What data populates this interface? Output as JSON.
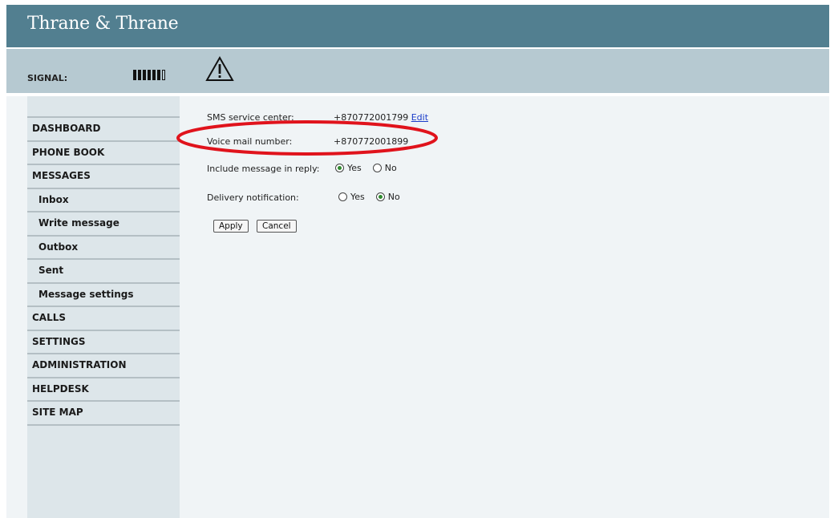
{
  "header": {
    "brand": "Thrane & Thrane"
  },
  "status": {
    "signal_label": "SIGNAL:",
    "signal_level": "6/7",
    "warning_icon": "warning-triangle-icon"
  },
  "sidebar": {
    "items": [
      {
        "label": "DASHBOARD",
        "level": 0
      },
      {
        "label": "PHONE BOOK",
        "level": 0
      },
      {
        "label": "MESSAGES",
        "level": 0
      },
      {
        "label": "Inbox",
        "level": 1
      },
      {
        "label": "Write message",
        "level": 1
      },
      {
        "label": "Outbox",
        "level": 1
      },
      {
        "label": "Sent",
        "level": 1
      },
      {
        "label": "Message settings",
        "level": 1
      },
      {
        "label": "CALLS",
        "level": 0
      },
      {
        "label": "SETTINGS",
        "level": 0
      },
      {
        "label": "ADMINISTRATION",
        "level": 0
      },
      {
        "label": "HELPDESK",
        "level": 0
      },
      {
        "label": "SITE MAP",
        "level": 0
      }
    ]
  },
  "form": {
    "sms_center_label": "SMS service center:",
    "sms_center_value": "+870772001799",
    "edit_link": "Edit",
    "voicemail_label": "Voice mail number:",
    "voicemail_value": "+870772001899",
    "include_msg_label": "Include message in reply:",
    "include_msg_options": [
      "Yes",
      "No"
    ],
    "include_msg_selected": "Yes",
    "delivery_label": "Delivery notification:",
    "delivery_options": [
      "Yes",
      "No"
    ],
    "delivery_selected": "No",
    "apply_label": "Apply",
    "cancel_label": "Cancel"
  },
  "colors": {
    "header": "#527f90",
    "statusbar": "#b6c9d1",
    "sidebar": "#dde6ea",
    "highlight_ellipse": "#e0131c"
  }
}
